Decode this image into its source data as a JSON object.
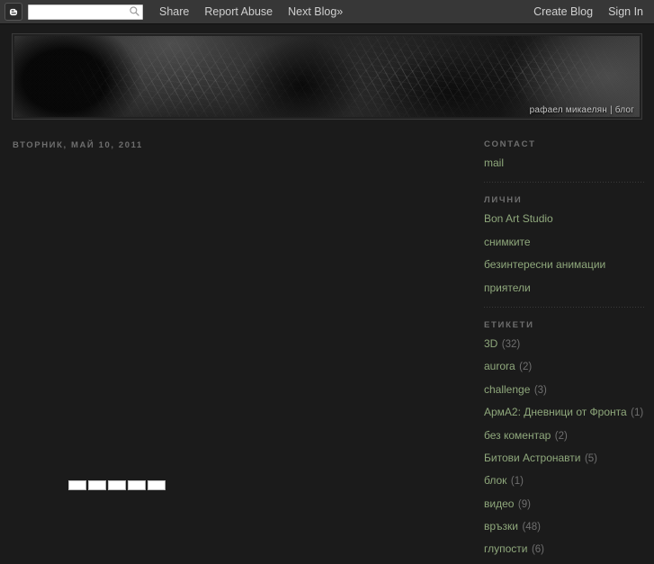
{
  "navbar": {
    "logo_icon": "blogger-b-icon",
    "search": {
      "value": "",
      "placeholder": ""
    },
    "search_icon": "search-icon",
    "links": [
      {
        "label": "Share",
        "name": "nav-share"
      },
      {
        "label": "Report Abuse",
        "name": "nav-report-abuse"
      },
      {
        "label": "Next Blog»",
        "name": "nav-next-blog"
      }
    ],
    "right_links": [
      {
        "label": "Create Blog",
        "name": "nav-create-blog"
      },
      {
        "label": "Sign In",
        "name": "nav-sign-in"
      }
    ]
  },
  "header": {
    "title": "рафаел микаелян | блог"
  },
  "main": {
    "post_date": "ВТОРНИК, МАЙ 10, 2011",
    "media_cells": 5
  },
  "sidebar": {
    "widgets": [
      {
        "title": "CONTACT",
        "name": "widget-contact",
        "items": [
          {
            "label": "mail",
            "count": ""
          }
        ]
      },
      {
        "title": "ЛИЧНИ",
        "name": "widget-lichni",
        "items": [
          {
            "label": "Bon Art Studio",
            "count": ""
          },
          {
            "label": "снимките",
            "count": ""
          },
          {
            "label": "безинтересни анимации",
            "count": ""
          },
          {
            "label": "приятели",
            "count": ""
          }
        ]
      },
      {
        "title": "ЕТИКЕТИ",
        "name": "widget-etiketi",
        "items": [
          {
            "label": "3D",
            "count": "(32)"
          },
          {
            "label": "aurora",
            "count": "(2)"
          },
          {
            "label": "challenge",
            "count": "(3)"
          },
          {
            "label": "АрмА2: Дневници от Фронта",
            "count": "(1)"
          },
          {
            "label": "без коментар",
            "count": "(2)"
          },
          {
            "label": "Битови Астронавти",
            "count": "(5)"
          },
          {
            "label": "блок",
            "count": "(1)"
          },
          {
            "label": "видео",
            "count": "(9)"
          },
          {
            "label": "връзки",
            "count": "(48)"
          },
          {
            "label": "глупости",
            "count": "(6)"
          }
        ]
      }
    ]
  },
  "colors": {
    "page_bg": "#1b1b1b",
    "navbar_bg": "#373737",
    "link_green": "#8fa87c",
    "heading_gray": "#6e6e6e",
    "count_gray": "#6f6f6f"
  }
}
